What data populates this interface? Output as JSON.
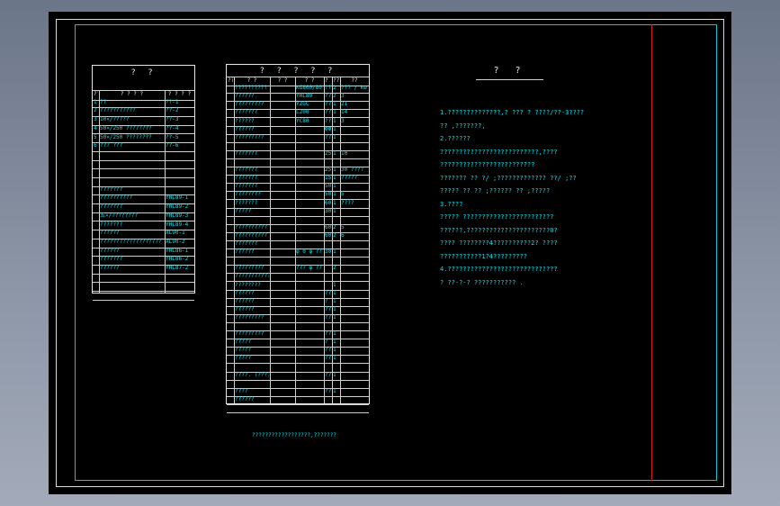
{
  "left_table": {
    "title": "? ?",
    "header": [
      "??",
      "? ? ? ?",
      "? ? ? ?"
    ],
    "rows": [
      [
        "1",
        "??",
        "??-1"
      ],
      [
        "2",
        "???????????",
        "??-2"
      ],
      [
        "3",
        "10×/?????",
        "??-3"
      ],
      [
        "4",
        "50×/250 ????????",
        "??-4"
      ],
      [
        "5",
        "50×/250 ????????",
        "??-5"
      ],
      [
        "6",
        "??? ???",
        "??-6"
      ],
      [
        "",
        "",
        ""
      ],
      [
        "",
        "",
        ""
      ],
      [
        "",
        "",
        ""
      ],
      [
        "",
        "",
        ""
      ],
      [
        "",
        "???????",
        ""
      ],
      [
        "",
        "??????????",
        "YHL89-1"
      ],
      [
        "",
        "???????",
        "YHL89-2"
      ],
      [
        "",
        "五×/????????",
        "YHL89-3"
      ],
      [
        "",
        "???????",
        "YHL89-4"
      ],
      [
        "",
        "??????",
        "XL90-1"
      ],
      [
        "",
        "???????????????????",
        "XL90-2"
      ],
      [
        "",
        "??????",
        "YHL86-1"
      ],
      [
        "",
        "???????",
        "YHL86-2"
      ],
      [
        "",
        "??????",
        "YHL87-2"
      ],
      [
        "",
        "",
        ""
      ],
      [
        "",
        "",
        ""
      ],
      [
        "",
        "",
        ""
      ]
    ]
  },
  "middle_table": {
    "title": "? ? ? ? ?",
    "header": [
      "??",
      "? ?",
      "? ?",
      "? ?",
      "? ?",
      "??",
      "??",
      "? ?"
    ],
    "rows": [
      [
        "",
        "??????????",
        "",
        "KG800/80",
        "??",
        "2",
        "??? / kw"
      ],
      [
        "",
        "??????",
        "",
        "YHL89",
        "????????",
        "2",
        "3"
      ],
      [
        "",
        "?????????",
        "",
        "YZGC",
        "???-1",
        "1",
        "21"
      ],
      [
        "",
        "???????",
        "",
        "L200",
        "???",
        "1",
        "14"
      ],
      [
        "",
        "??????",
        "",
        "YC80",
        "???-1.5",
        "1",
        "3"
      ],
      [
        "",
        "??????",
        "",
        "",
        "ФФ",
        "1",
        ""
      ],
      [
        "",
        "?????????",
        "",
        "",
        "???-1",
        "1",
        ""
      ],
      [
        "",
        "",
        "",
        "",
        "",
        "",
        ""
      ],
      [
        "",
        "???????",
        "",
        "",
        "250/φe",
        "1",
        "10"
      ],
      [
        "",
        "",
        "",
        "",
        "",
        "",
        ""
      ],
      [
        "",
        "???????",
        "",
        "",
        "250/1500",
        "1",
        "30 ????"
      ],
      [
        "",
        "???????",
        "",
        "",
        "1500/1500",
        "1",
        "?????"
      ],
      [
        "",
        "???????",
        "",
        "",
        "500/1500",
        "1",
        ""
      ],
      [
        "",
        "????????",
        "",
        "",
        "500/1500",
        "1",
        "5"
      ],
      [
        "",
        "???????",
        "",
        "",
        "600/1500",
        "1",
        "????"
      ],
      [
        "",
        "?????",
        "",
        "",
        "3000/2500",
        "1",
        ""
      ],
      [
        "",
        "",
        "",
        "",
        "",
        "",
        ""
      ],
      [
        "",
        "??????????",
        "",
        "",
        "600/1500",
        "2",
        "5"
      ],
      [
        "",
        "??????????",
        "",
        "",
        "600/5",
        "2",
        "6"
      ],
      [
        "",
        "???????",
        "",
        "",
        "",
        "",
        ""
      ],
      [
        "",
        "??????",
        "",
        "φ 0 φ ???",
        "3000",
        "1",
        ""
      ],
      [
        "",
        "",
        "",
        "",
        "",
        "",
        ""
      ],
      [
        "",
        "?????????",
        "",
        "??? φ ???",
        "",
        "2",
        ""
      ],
      [
        "",
        "????????????",
        "",
        "",
        "",
        "",
        ""
      ],
      [
        "",
        "????????",
        "",
        "",
        "",
        "1",
        ""
      ],
      [
        "",
        "??????",
        "",
        "",
        "??? 8",
        "1",
        ""
      ],
      [
        "",
        "??????",
        "",
        "",
        "? ????",
        "1",
        ""
      ],
      [
        "",
        "??????",
        "",
        "",
        "???? 8",
        "1",
        ""
      ],
      [
        "",
        "?????????",
        "",
        "",
        "??????",
        "1",
        ""
      ],
      [
        "",
        "",
        "",
        "",
        "",
        "",
        ""
      ],
      [
        "",
        "?????????",
        "",
        "",
        "?? ??",
        "1",
        ""
      ],
      [
        "",
        "?????",
        "",
        "",
        "? ??",
        "1",
        ""
      ],
      [
        "",
        "?????",
        "",
        "",
        "???",
        "1",
        ""
      ],
      [
        "",
        "?????",
        "",
        "",
        "???",
        "1",
        ""
      ],
      [
        "",
        "",
        "",
        "",
        "",
        "",
        ""
      ],
      [
        "",
        "????. (???)",
        "",
        "",
        "??",
        "1",
        ""
      ],
      [
        "",
        "",
        "",
        "",
        "",
        "",
        ""
      ],
      [
        "",
        "????",
        "",
        "",
        "??",
        "1",
        ""
      ],
      [
        "",
        "??????",
        "",
        "",
        "",
        "",
        ""
      ],
      [
        "",
        "",
        "",
        "",
        "",
        "",
        ""
      ]
    ]
  },
  "notes": {
    "title": "? ?",
    "lines": [
      "1.??????????????,?      ??? ?  ????/??-3????",
      "  ??  ,???????,",
      "2.??????",
      "  ??????????????????????????,????",
      "  ?????????????????????????",
      "  ???????   ??  ?/     ;????????????? ??/      ;??",
      "  ?????  ??  ??      ;?????? ??       ;?????",
      "3.????",
      "  ?????  ????????????????????????",
      "  ??????,??????????????????????0?",
      "  ????  ????????4??????????2?       ????",
      "  ???????????1?4?????????",
      "4.?????????????????????????????",
      "  ? ??-?-?     ???????????  ."
    ]
  },
  "footer": "??????????????????,???????",
  "colors": {
    "cyan": "#00e6f0",
    "red": "#d61a1a",
    "white": "#e8e8e8"
  }
}
